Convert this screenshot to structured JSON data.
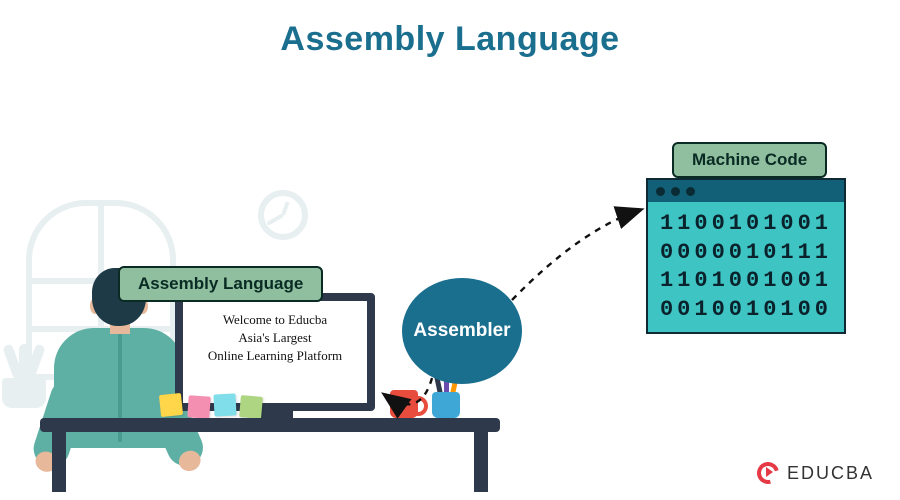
{
  "title": "Assembly Language",
  "labels": {
    "assembly_language": "Assembly Language",
    "machine_code": "Machine Code",
    "assembler": "Assembler"
  },
  "screen": {
    "line1": "Welcome to Educba",
    "line2": "Asia's Largest",
    "line3": "Online Learning Platform"
  },
  "machine_code_lines": {
    "r1": "1100101001",
    "r2": "0000010111",
    "r3": "1101001001",
    "r4": "0010010100"
  },
  "brand": "EDUCBA"
}
